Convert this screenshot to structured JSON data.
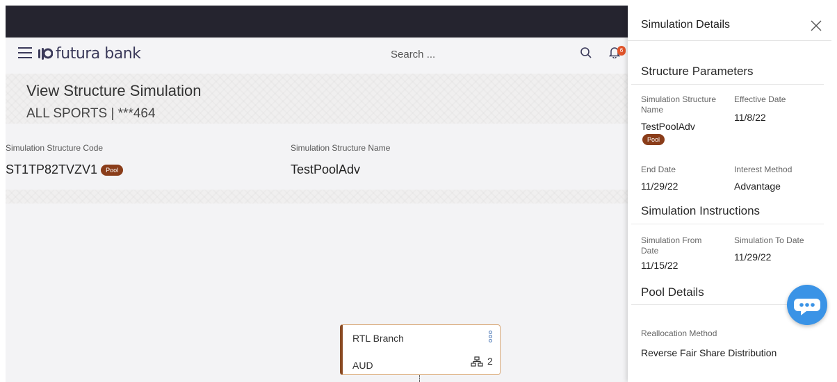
{
  "header": {
    "brand": "futura bank",
    "search_placeholder": "Search ...",
    "notification_count": "6"
  },
  "page": {
    "title": "View Structure Simulation",
    "subtitle": "ALL SPORTS | ***464",
    "code_label": "Simulation Structure Code",
    "code_value": "ST1TP82TVZV1",
    "code_badge": "Pool",
    "name_label": "Simulation Structure Name",
    "name_value": "TestPoolAdv"
  },
  "node": {
    "title": "RTL Branch",
    "currency": "AUD",
    "children_count": "2"
  },
  "panel": {
    "title": "Simulation Details",
    "structure_parameters": {
      "heading": "Structure Parameters",
      "sim_name_label": "Simulation Structure Name",
      "sim_name_value": "TestPoolAdv",
      "sim_name_badge": "Pool",
      "effective_date_label": "Effective Date",
      "effective_date_value": "11/8/22",
      "end_date_label": "End Date",
      "end_date_value": "11/29/22",
      "interest_method_label": "Interest Method",
      "interest_method_value": "Advantage"
    },
    "simulation_instructions": {
      "heading": "Simulation Instructions",
      "from_label": "Simulation From Date",
      "from_value": "11/15/22",
      "to_label": "Simulation To Date",
      "to_value": "11/29/22"
    },
    "pool_details": {
      "heading": "Pool Details",
      "reallocation_label": "Reallocation Method",
      "reallocation_value": "Reverse Fair Share Distribution"
    }
  }
}
